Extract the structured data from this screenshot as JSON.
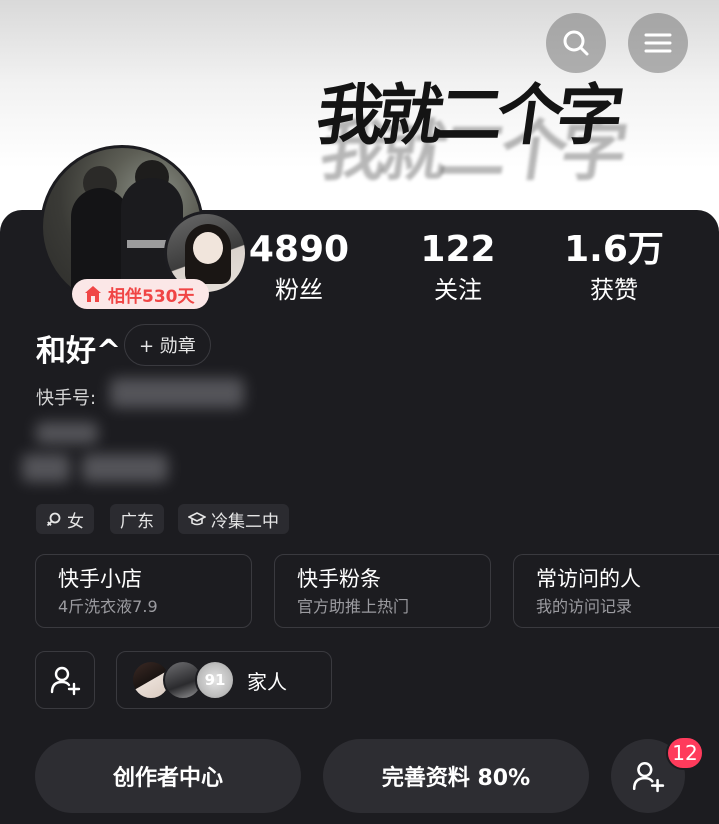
{
  "header": {
    "banner_text": "我就二个字"
  },
  "profile": {
    "companion_badge": "相伴530天",
    "username": "和好^",
    "medal_button": "+ 勋章",
    "kuaishou_id_label": "快手号:"
  },
  "stats": [
    {
      "value": "4890",
      "label": "粉丝"
    },
    {
      "value": "122",
      "label": "关注"
    },
    {
      "value": "1.6万",
      "label": "获赞"
    }
  ],
  "tags": [
    {
      "icon": "female-icon",
      "label": "女"
    },
    {
      "icon": "",
      "label": "广东"
    },
    {
      "icon": "graduation-cap-icon",
      "label": "冷集二中"
    }
  ],
  "cards": [
    {
      "title": "快手小店",
      "subtitle": "4斤洗衣液7.9"
    },
    {
      "title": "快手粉条",
      "subtitle": "官方助推上热门"
    },
    {
      "title": "常访问的人",
      "subtitle": "我的访问记录"
    }
  ],
  "family": {
    "label": "家人",
    "third_avatar_text": "91"
  },
  "actions": {
    "creator_center": "创作者中心",
    "complete_profile": "完善资料 80%",
    "friend_requests_count": "12"
  },
  "colors": {
    "background": "#1c1c20",
    "accent_red": "#ff3b5c",
    "badge_text": "#f04545"
  }
}
